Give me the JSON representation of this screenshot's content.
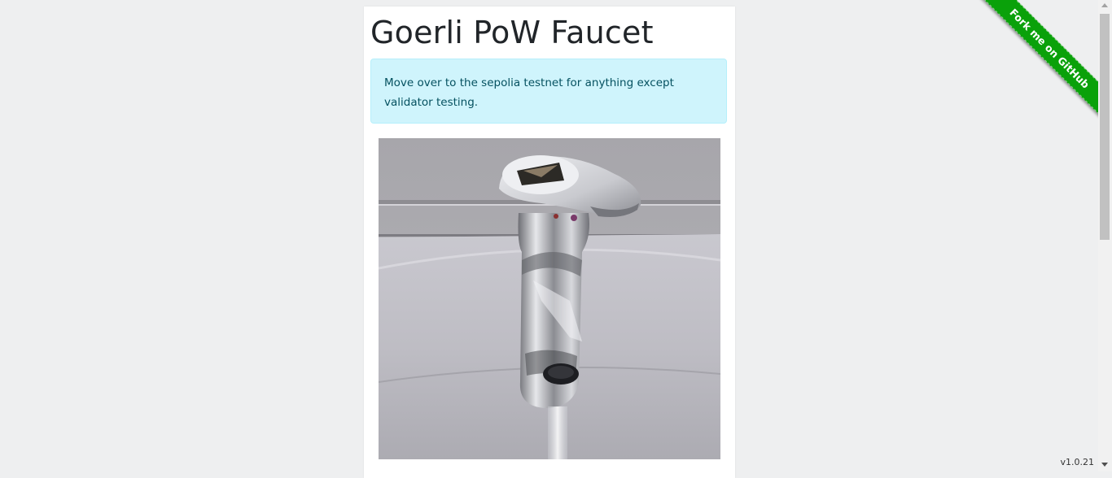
{
  "header": {
    "title": "Goerli PoW Faucet"
  },
  "notice": {
    "text": "Move over to the sepolia testnet for anything except validator testing."
  },
  "hero": {
    "image_name": "faucet-tap-with-ethereum-logo"
  },
  "ribbon": {
    "label": "Fork me on GitHub",
    "color": "#0aa10a"
  },
  "footer": {
    "version": "v1.0.21"
  },
  "colors": {
    "page_bg": "#eeeff0",
    "alert_bg": "#cff4fc",
    "alert_text": "#055160"
  }
}
